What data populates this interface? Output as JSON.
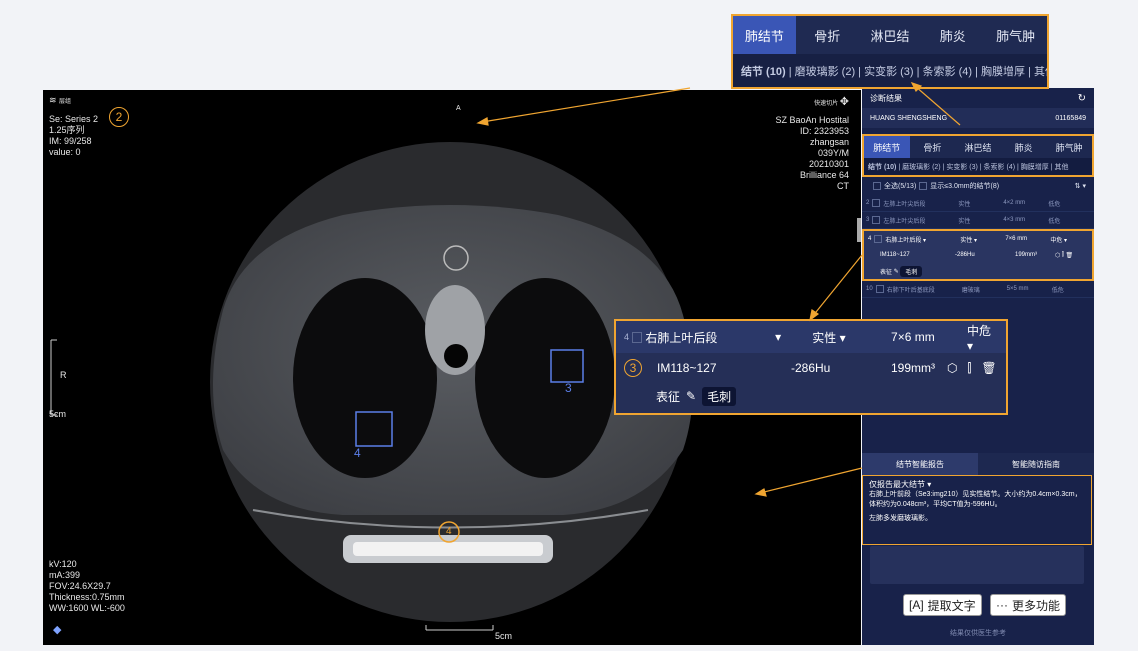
{
  "top_tabs": {
    "tabs": [
      "肺结节",
      "骨折",
      "淋巴结",
      "肺炎",
      "肺气肿"
    ],
    "active": 0,
    "sub": "结节 (10) | 磨玻璃影 (2) | 实变影 (3) | 条索影 (4) | 胸膜增厚 | 其他",
    "sub_bold": "结节 (10)",
    "sub_rest": "| 磨玻璃影 (2) | 实变影 (3) | 条索影 (4) | 胸膜增厚 | 其他"
  },
  "viewer": {
    "top_left": [
      "Se: Series 2",
      "1.25序列",
      "IM: 99/258",
      "value: 0"
    ],
    "layer_label": "层组",
    "circle_num": "2",
    "orient_top": "A",
    "orient_left": "R",
    "top_right_label": "快速切片",
    "top_right": [
      "SZ BaoAn Hostital",
      "ID: 2323953",
      "zhangsan",
      "039Y/M",
      "20210301",
      "Brilliance 64",
      "CT"
    ],
    "bottom_left": [
      "kV:120",
      "mA:399",
      "FOV:24.6X29.7",
      "Thickness:0.75mm",
      "WW:1600  WL:-600"
    ],
    "scale_left": "5cm",
    "scale_bottom": "5cm",
    "nodule_3": "3",
    "nodule_4": "4",
    "circle_4": "4"
  },
  "panel": {
    "title": "诊断结果",
    "patient": "HUANG SHENGSHENG",
    "patient_id": "01165849",
    "tabs": [
      "肺结节",
      "骨折",
      "淋巴结",
      "肺炎",
      "肺气肿"
    ],
    "sub_bold": "结节 (10)",
    "sub_rest": "| 磨玻璃影 (2) | 实变影 (3) | 条索影 (4) | 胸膜增厚 | 其他",
    "select_all": "全选(5/13)",
    "show_filter": "显示≤3.0mm的结节(8)",
    "rows": [
      {
        "n": "2",
        "loc": "左肺上叶尖后段",
        "type": "实性",
        "size": "4×2 mm",
        "risk": "低危"
      },
      {
        "n": "3",
        "loc": "左肺上叶尖后段",
        "type": "实性",
        "size": "4×3 mm",
        "risk": "低危"
      },
      {
        "n": "4",
        "loc": "右肺上叶后段",
        "type": "实性",
        "size": "7×6 mm",
        "risk": "中危"
      },
      {
        "n": "10",
        "loc": "右肺下叶后基底段",
        "type": "磨玻璃",
        "size": "5×5 mm",
        "risk": "低危"
      }
    ],
    "sel_im": "IM118~127",
    "sel_hu": "-286Hu",
    "sel_vol": "199mm³",
    "sign_label": "表征",
    "sign_tag": "毛刺",
    "report_tab": "结节智能报告",
    "followup_tab": "智能随访指南",
    "report_only": "仅报告最大结节",
    "report_text": "右肺上叶前段（Se3:img210）见实性结节。大小约为0.4cm×0.3cm，体积约为0.048cm³，平均CT值为-596HU。",
    "report_text2": "左肺多发磨玻璃影。",
    "footer": "结果仅供医生参考"
  },
  "zoom": {
    "n": "4",
    "loc": "右肺上叶后段",
    "type": "实性",
    "size": "7×6 mm",
    "risk": "中危",
    "circle_num": "3",
    "im": "IM118~127",
    "hu": "-286Hu",
    "vol": "199mm³",
    "sign_label": "表征",
    "sign_tag": "毛刺"
  },
  "bottom_buttons": {
    "extract": "提取文字",
    "more": "更多功能"
  },
  "colors": {
    "accent": "#f0a531",
    "panel": "#18224a",
    "active_tab": "#3a56b6",
    "box": "#5b7ee8"
  }
}
